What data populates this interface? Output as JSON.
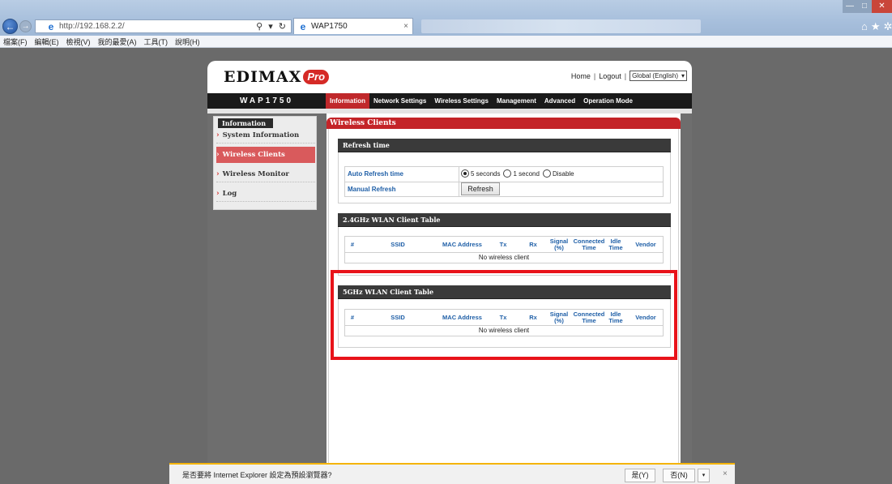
{
  "browser": {
    "address": "http://192.168.2.2/",
    "address_tools": "⚲ ▾ ↻",
    "tab_title": "WAP1750",
    "tab_close": "×",
    "back_glyph": "←",
    "forward_glyph": "→",
    "ie_glyph": "e",
    "favorites_glyphs": "⌂★✲",
    "window_min": "—",
    "window_max": "□",
    "window_close": "✕",
    "menu": [
      "檔案(F)",
      "編輯(E)",
      "檢視(V)",
      "我的最愛(A)",
      "工具(T)",
      "說明(H)"
    ]
  },
  "header": {
    "logo_text": "EDIMAX",
    "logo_pro": "Pro",
    "home": "Home",
    "logout": "Logout",
    "separator": "|",
    "language": "Global (English)",
    "lang_chevron": "▾"
  },
  "nav": {
    "model": "WAP1750",
    "tabs": [
      "Information",
      "Network Settings",
      "Wireless Settings",
      "Management",
      "Advanced",
      "Operation Mode"
    ],
    "active_tab": "Information"
  },
  "sidebar": {
    "title": "Information",
    "arrow": "›",
    "items": [
      "System Information",
      "Wireless Clients",
      "Wireless Monitor",
      "Log"
    ],
    "active_item": "Wireless Clients"
  },
  "main": {
    "title": "Wireless Clients",
    "refresh": {
      "section_title": "Refresh time",
      "auto_label": "Auto Refresh time",
      "options": [
        "5 seconds",
        "1 second",
        "Disable"
      ],
      "selected": "5 seconds",
      "manual_label": "Manual Refresh",
      "button": "Refresh"
    },
    "table_24": {
      "section_title": "2.4GHz WLAN Client Table",
      "columns": [
        "#",
        "SSID",
        "MAC Address",
        "Tx",
        "Rx",
        "Signal (%)",
        "Connected Time",
        "Idle Time",
        "Vendor"
      ],
      "empty": "No wireless client"
    },
    "table_5": {
      "section_title": "5GHz WLAN Client Table",
      "columns": [
        "#",
        "SSID",
        "MAC Address",
        "Tx",
        "Rx",
        "Signal (%)",
        "Connected Time",
        "Idle Time",
        "Vendor"
      ],
      "empty": "No wireless client"
    }
  },
  "notification": {
    "text": "是否要將 Internet Explorer 設定為預設瀏覽器?",
    "yes": "是(Y)",
    "no": "否(N)",
    "dropdown": "▾",
    "close": "×"
  },
  "colors": {
    "brand_red": "#c42428",
    "highlight_red": "#e8131a",
    "label_blue": "#1f5fa7"
  }
}
